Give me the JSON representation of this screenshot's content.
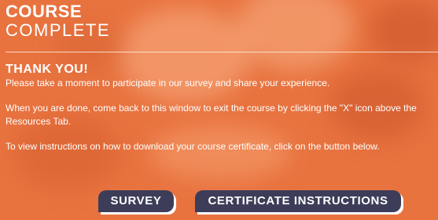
{
  "header": {
    "line1": "COURSE",
    "line2": "COMPLETE"
  },
  "content": {
    "heading": "THANK YOU!",
    "paragraphs": [
      "Please take a moment to participate in our survey and share your experience.",
      "When you are done, come back to this window to exit the course by clicking the \"X\" icon above the Resources Tab.",
      "To view instructions on how to download your course certificate, click on the button below."
    ]
  },
  "buttons": {
    "survey_label": "SURVEY",
    "certificate_label": "CERTIFICATE INSTRUCTIONS"
  },
  "colors": {
    "background_orange": "#e8733f",
    "button_navy": "#3d3d5a",
    "text": "#ffffff"
  }
}
